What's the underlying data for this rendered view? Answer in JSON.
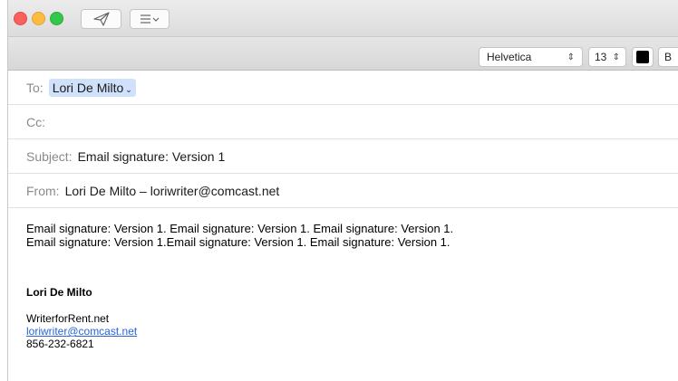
{
  "toolbar": {
    "send_icon": "paper-plane-icon",
    "list_icon": "list-dropdown-icon"
  },
  "format": {
    "font_family": "Helvetica",
    "font_size": "13",
    "color": "#000000",
    "bold_label": "B"
  },
  "header": {
    "to_label": "To:",
    "to_recipient": "Lori De Milto",
    "cc_label": "Cc:",
    "subject_label": "Subject:",
    "subject_value": "Email signature: Version 1",
    "from_label": "From:",
    "from_value": "Lori De Milto – loriwriter@comcast.net"
  },
  "body": {
    "line1": "Email signature: Version 1. Email signature: Version 1. Email signature: Version 1.",
    "line2": "Email signature: Version 1.Email signature: Version 1. Email signature: Version 1."
  },
  "signature": {
    "name": "Lori De Milto",
    "company": "WriterforRent.net",
    "email": "loriwriter@comcast.net",
    "phone": "856-232-6821"
  }
}
